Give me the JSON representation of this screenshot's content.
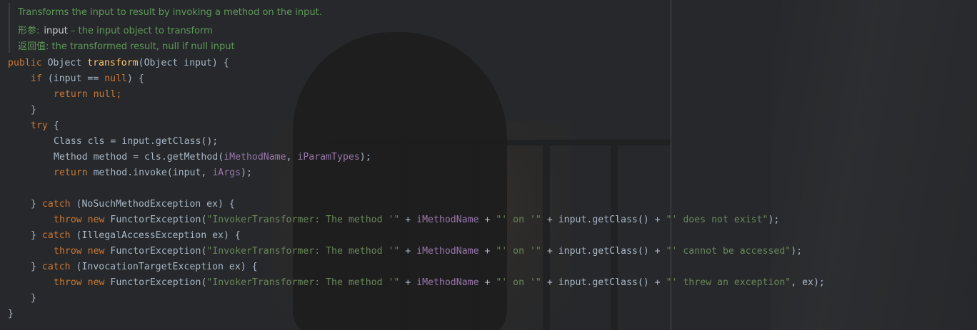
{
  "doc": {
    "summary": "Transforms the input to result by invoking a method on the input.",
    "param_label": "形参:",
    "param_name": "input",
    "param_desc": "– the input object to transform",
    "return_label": "返回值:",
    "return_desc": "the transformed result, null if null input"
  },
  "code": {
    "l1": {
      "kw": "public ",
      "t1": "Object ",
      "fn": "transform",
      "t2": "(Object input) {"
    },
    "l2": {
      "kw": "if ",
      "t1": "(input == ",
      "kw2": "null",
      "t2": ") {"
    },
    "l3": {
      "kw": "return null",
      "t1": ";"
    },
    "l4": "}",
    "l5": {
      "kw": "try ",
      "t1": "{"
    },
    "l6": "Class cls = input.getClass();",
    "l7": {
      "t1": "Method method = cls.getMethod(",
      "f1": "iMethodName",
      "t2": ", ",
      "f2": "iParamTypes",
      "t3": ");"
    },
    "l8": {
      "kw": "return ",
      "t1": "method.invoke(input, ",
      "f1": "iArgs",
      "t2": ");"
    },
    "l10": {
      "t1": "} ",
      "kw": "catch ",
      "t2": "(NoSuchMethodException ex) {"
    },
    "l11": {
      "kw": "throw new ",
      "t1": "FunctorException(",
      "s1": "\"InvokerTransformer: The method '\"",
      "t2": " + ",
      "f1": "iMethodName",
      "t3": " + ",
      "s2": "\"' on '\"",
      "t4": " + input.getClass() + ",
      "s3": "\"' does not exist\"",
      "t5": ");"
    },
    "l12": {
      "t1": "} ",
      "kw": "catch ",
      "t2": "(IllegalAccessException ex) {"
    },
    "l13": {
      "kw": "throw new ",
      "t1": "FunctorException(",
      "s1": "\"InvokerTransformer: The method '\"",
      "t2": " + ",
      "f1": "iMethodName",
      "t3": " + ",
      "s2": "\"' on '\"",
      "t4": " + input.getClass() + ",
      "s3": "\"' cannot be accessed\"",
      "t5": ");"
    },
    "l14": {
      "t1": "} ",
      "kw": "catch ",
      "t2": "(InvocationTargetException ex) {"
    },
    "l15": {
      "kw": "throw new ",
      "t1": "FunctorException(",
      "s1": "\"InvokerTransformer: The method '\"",
      "t2": " + ",
      "f1": "iMethodName",
      "t3": " + ",
      "s2": "\"' on '\"",
      "t4": " + input.getClass() + ",
      "s3": "\"' threw an exception\"",
      "t5": ", ex);"
    },
    "l16": "}",
    "l17": "}"
  },
  "colors": {
    "background": "#26282b",
    "keyword": "#cc7832",
    "method_decl": "#ffc66d",
    "string": "#6a8759",
    "field": "#9876aa",
    "text": "#a9b7c6",
    "doc_comment": "#5f9b58"
  }
}
